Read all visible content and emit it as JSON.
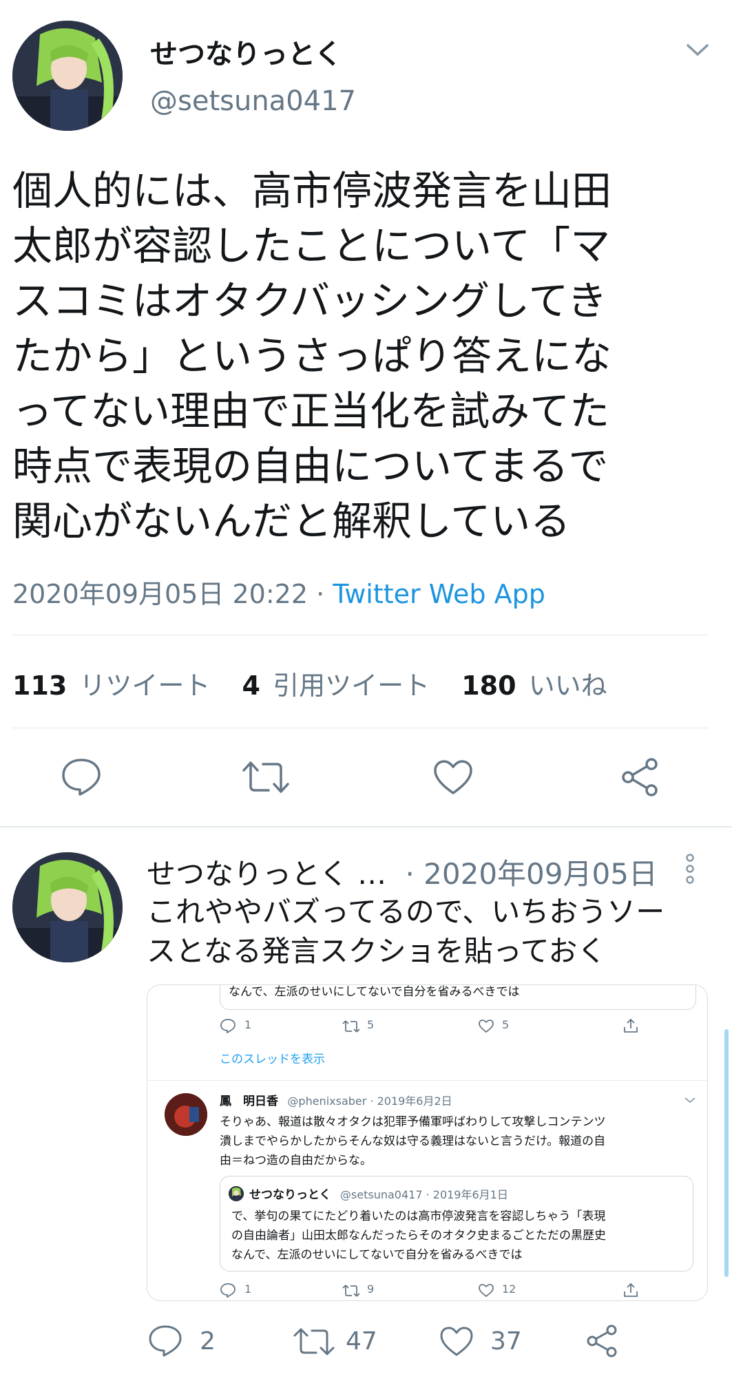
{
  "tweet": {
    "display_name": "せつなりっとく",
    "handle": "@setsuna0417",
    "text_lines": [
      "個人的には、高市停波発言を山田",
      "太郎が容認したことについて「マ",
      "スコミはオタクバッシングしてき",
      "たから」というさっぱり答えにな",
      "ってない理由で正当化を試みてた",
      "時点で表現の自由についてまるで",
      "関心がないんだと解釈している"
    ],
    "timestamp": "2020年09月05日 20:22",
    "separator": " · ",
    "source": "Twitter Web App",
    "stats": {
      "retweets_count": "113",
      "retweets_label": "リツイート",
      "quotes_count": "4",
      "quotes_label": "引用ツイート",
      "likes_count": "180",
      "likes_label": "いいね"
    }
  },
  "reply": {
    "display_name": "せつなりっとく …",
    "date": "· 2020年09月05日",
    "text_lines": [
      "これややバズってるので、いちおうソー",
      "スとなる発言スクショを貼っておく"
    ],
    "reply_count": "2",
    "retweet_count": "47",
    "like_count": "37"
  },
  "embed": {
    "top_cut_text": "なんで、左派のせいにしてないで自分を省みるべきでは",
    "top_reply": "1",
    "top_retweet": "5",
    "top_like": "5",
    "show_thread": "このスレッドを表示",
    "post": {
      "name": "鳳　明日香",
      "handle_date": "@phenixsaber · 2019年6月2日",
      "lines": [
        "そりゃあ、報道は散々オタクは犯罪予備軍呼ばわりして攻撃しコンテンツ",
        "潰しまでやらかしたからそんな奴は守る義理はないと言うだけ。報道の自",
        "由＝ねつ造の自由だからな。"
      ]
    },
    "quoted": {
      "name": "せつなりっとく",
      "handle_date": "@setsuna0417 · 2019年6月1日",
      "lines": [
        "で、挙句の果てにたどり着いたのは高市停波発言を容認しちゃう「表現",
        "の自由論者」山田太郎なんだったらそのオタク史まるごとただの黒歴史",
        "なんで、左派のせいにしてないで自分を省みるべきでは"
      ]
    },
    "bottom_reply": "1",
    "bottom_retweet": "9",
    "bottom_like": "12"
  },
  "colors": {
    "text": "#14171a",
    "muted": "#657786",
    "link": "#1da1f2",
    "divider": "#e1e8ed"
  }
}
